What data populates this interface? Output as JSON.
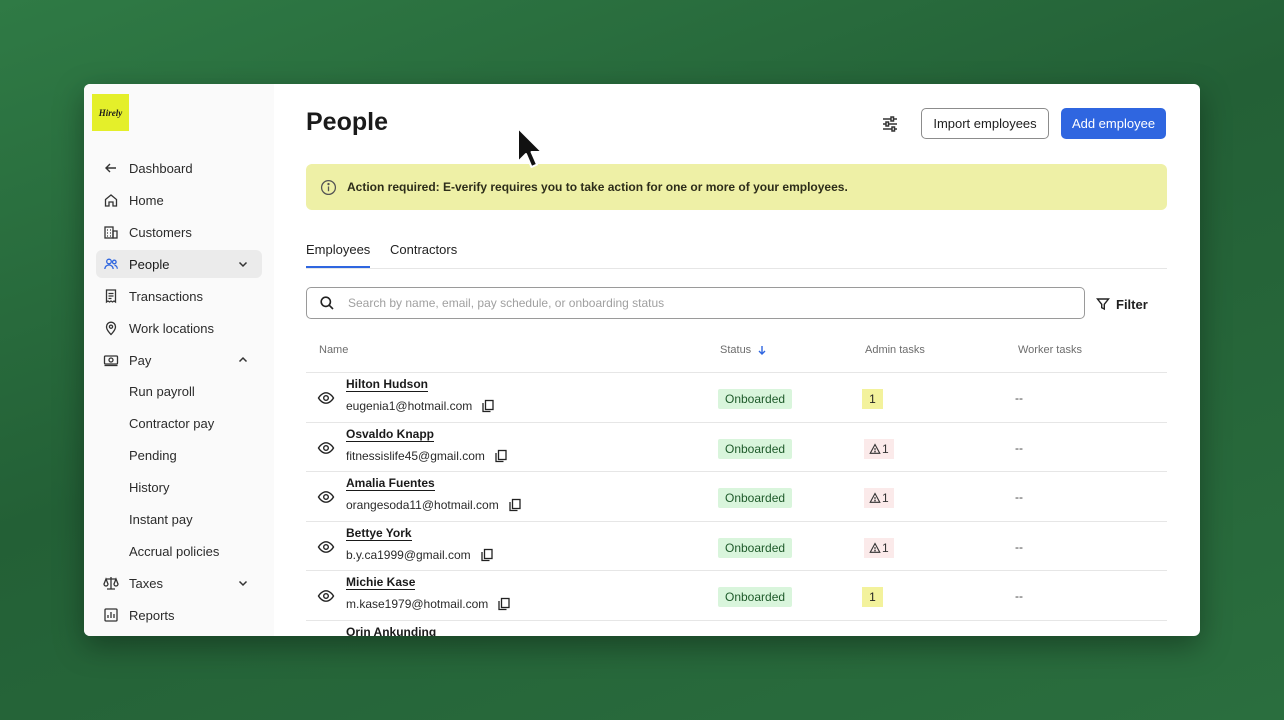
{
  "brand": {
    "logo_text": "Hirely",
    "logo_color": "#e4ef2a"
  },
  "sidebar": {
    "items": [
      {
        "label": "Dashboard",
        "icon": "arrow-left-icon"
      },
      {
        "label": "Home",
        "icon": "home-icon"
      },
      {
        "label": "Customers",
        "icon": "building-icon"
      },
      {
        "label": "People",
        "icon": "people-icon",
        "active": true,
        "expanded": false
      },
      {
        "label": "Transactions",
        "icon": "receipt-icon"
      },
      {
        "label": "Work locations",
        "icon": "map-pin-icon"
      },
      {
        "label": "Pay",
        "icon": "money-icon",
        "expanded": true
      },
      {
        "label": "Taxes",
        "icon": "scale-icon",
        "expanded": false
      },
      {
        "label": "Reports",
        "icon": "report-icon"
      }
    ],
    "pay_subitems": [
      "Run payroll",
      "Contractor pay",
      "Pending",
      "History",
      "Instant pay",
      "Accrual policies"
    ]
  },
  "header": {
    "title": "People",
    "import_label": "Import employees",
    "add_label": "Add employee"
  },
  "banner": {
    "text": "Action required: E-verify requires you to take action for one or more of your employees.",
    "color": "#eef0a6"
  },
  "tabs": [
    {
      "label": "Employees",
      "active": true
    },
    {
      "label": "Contractors",
      "active": false
    }
  ],
  "search": {
    "placeholder": "Search by name, email, pay schedule, or onboarding status",
    "value": ""
  },
  "filter_label": "Filter",
  "table": {
    "columns": [
      "Name",
      "Status",
      "Admin tasks",
      "Worker tasks"
    ],
    "sort": {
      "column": "Status",
      "direction": "descending"
    },
    "rows": [
      {
        "name": "Hilton Hudson",
        "email": "eugenia1@hotmail.com",
        "status": "Onboarded",
        "admin_tasks": "1",
        "admin_warning": false,
        "worker_tasks": "--"
      },
      {
        "name": "Osvaldo Knapp",
        "email": "fitnessislife45@gmail.com",
        "status": "Onboarded",
        "admin_tasks": "1",
        "admin_warning": true,
        "worker_tasks": "--"
      },
      {
        "name": "Amalia Fuentes",
        "email": "orangesoda11@hotmail.com",
        "status": "Onboarded",
        "admin_tasks": "1",
        "admin_warning": true,
        "worker_tasks": "--"
      },
      {
        "name": "Bettye York",
        "email": "b.y.ca1999@gmail.com",
        "status": "Onboarded",
        "admin_tasks": "1",
        "admin_warning": true,
        "worker_tasks": "--"
      },
      {
        "name": "Michie Kase",
        "email": "m.kase1979@hotmail.com",
        "status": "Onboarded",
        "admin_tasks": "1",
        "admin_warning": false,
        "worker_tasks": "--"
      },
      {
        "name": "Orin Ankunding",
        "email": "",
        "status": "",
        "admin_tasks": "",
        "admin_warning": false,
        "worker_tasks": ""
      }
    ]
  },
  "colors": {
    "primary": "#2f66e0",
    "status_bg": "#d9f5dc",
    "admin_yellow": "#f3f29c",
    "admin_warn_bg": "#fbeaea"
  }
}
